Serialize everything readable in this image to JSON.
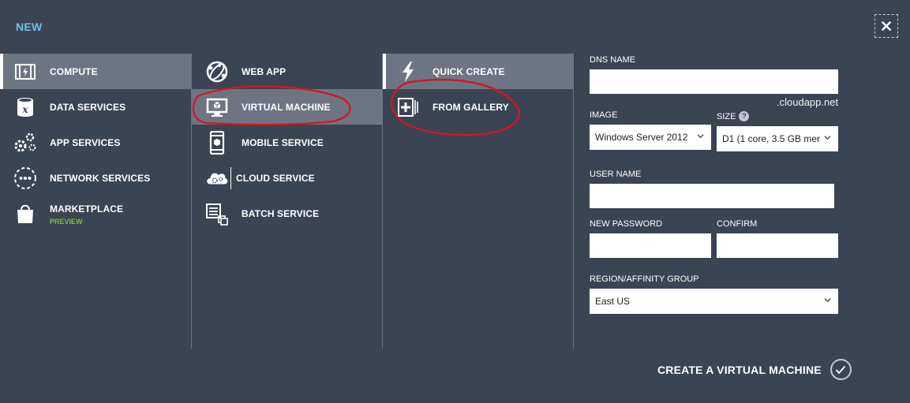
{
  "header": {
    "title": "NEW"
  },
  "col1": [
    {
      "label": "COMPUTE",
      "icon": "compute-icon",
      "selected": true
    },
    {
      "label": "DATA SERVICES",
      "icon": "data-services-icon"
    },
    {
      "label": "APP SERVICES",
      "icon": "app-services-icon"
    },
    {
      "label": "NETWORK SERVICES",
      "icon": "network-services-icon"
    },
    {
      "label": "MARKETPLACE",
      "sublabel": "PREVIEW",
      "icon": "marketplace-icon"
    }
  ],
  "col2": [
    {
      "label": "WEB APP",
      "icon": "web-app-icon"
    },
    {
      "label": "VIRTUAL MACHINE",
      "icon": "virtual-machine-icon",
      "selected": true
    },
    {
      "label": "MOBILE SERVICE",
      "icon": "mobile-service-icon"
    },
    {
      "label": "CLOUD SERVICE",
      "icon": "cloud-service-icon"
    },
    {
      "label": "BATCH SERVICE",
      "icon": "batch-service-icon"
    }
  ],
  "col3": [
    {
      "label": "QUICK CREATE",
      "icon": "lightning-icon",
      "selected": true
    },
    {
      "label": "FROM GALLERY",
      "icon": "gallery-add-icon"
    }
  ],
  "form": {
    "dns_label": "DNS NAME",
    "dns_value": "",
    "dns_suffix": ".cloudapp.net",
    "image_label": "IMAGE",
    "image_value": "Windows Server 2012",
    "size_label": "SIZE",
    "size_help": "?",
    "size_value": "D1 (1 core, 3.5 GB mer",
    "username_label": "USER NAME",
    "username_value": "",
    "password_label": "NEW PASSWORD",
    "confirm_label": "CONFIRM",
    "region_label": "REGION/AFFINITY GROUP",
    "region_value": "East US"
  },
  "footer": {
    "create_label": "CREATE A VIRTUAL MACHINE"
  },
  "colors": {
    "background": "#3b4452",
    "selected": "#6d7583",
    "accent": "#6cc0ec",
    "annotation": "#d9141e",
    "preview": "#7bbf3a"
  }
}
